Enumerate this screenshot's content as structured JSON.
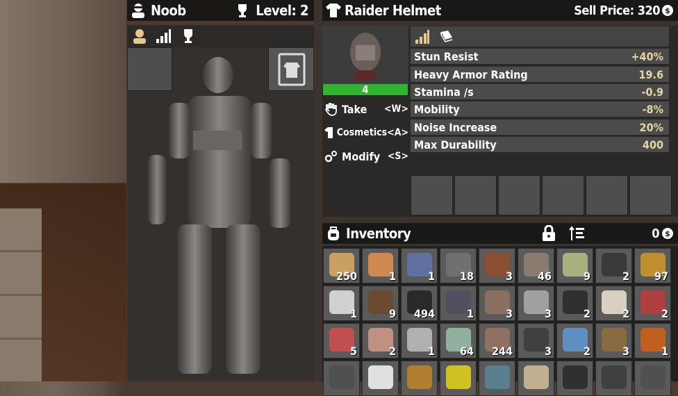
{
  "player": {
    "name": "Noob",
    "level_label": "Level: 2"
  },
  "item": {
    "title": "Raider Helmet",
    "sell_price_label": "Sell Price: 320",
    "quality": "4"
  },
  "actions": [
    {
      "label": "Take",
      "key": "<W>"
    },
    {
      "label": "Cosmetics",
      "key": "<A>"
    },
    {
      "label": "Modify",
      "key": "<S>"
    }
  ],
  "stats": [
    {
      "name": "Stun Resist",
      "value": "+40%"
    },
    {
      "name": "Heavy Armor Rating",
      "value": "19.6"
    },
    {
      "name": "Stamina /s",
      "value": "-0.9"
    },
    {
      "name": "Mobility",
      "value": "-8%"
    },
    {
      "name": "Noise Increase",
      "value": "20%"
    },
    {
      "name": "Max Durability",
      "value": "400"
    }
  ],
  "inventory": {
    "title": "Inventory",
    "money": "0",
    "slots": [
      {
        "count": "250",
        "color": "#c8a060"
      },
      {
        "count": "1",
        "color": "#d08a50"
      },
      {
        "count": "1",
        "color": "#6070a0"
      },
      {
        "count": "18",
        "color": "#707070"
      },
      {
        "count": "3",
        "color": "#8a5030"
      },
      {
        "count": "46",
        "color": "#8a7a70"
      },
      {
        "count": "9",
        "color": "#a8b080"
      },
      {
        "count": "2",
        "color": "#3a3a3a"
      },
      {
        "count": "97",
        "color": "#c09030"
      },
      {
        "count": "1",
        "color": "#d0d0d0"
      },
      {
        "count": "9",
        "color": "#6a4a30"
      },
      {
        "count": "494",
        "color": "#2a2a2a"
      },
      {
        "count": "1",
        "color": "#505060"
      },
      {
        "count": "3",
        "color": "#8a7060"
      },
      {
        "count": "3",
        "color": "#a0a0a0"
      },
      {
        "count": "2",
        "color": "#303030"
      },
      {
        "count": "2",
        "color": "#d8d0c0"
      },
      {
        "count": "2",
        "color": "#b04040"
      },
      {
        "count": "5",
        "color": "#c05050"
      },
      {
        "count": "2",
        "color": "#c09080"
      },
      {
        "count": "1",
        "color": "#b0b0b0"
      },
      {
        "count": "64",
        "color": "#90b0a0"
      },
      {
        "count": "244",
        "color": "#907060"
      },
      {
        "count": "3",
        "color": "#404040"
      },
      {
        "count": "2",
        "color": "#6090c0"
      },
      {
        "count": "3",
        "color": "#8a6a40"
      },
      {
        "count": "1",
        "color": "#c06020"
      },
      {
        "count": "",
        "color": "#505050"
      },
      {
        "count": "",
        "color": "#e0e0e0"
      },
      {
        "count": "",
        "color": "#b08030"
      },
      {
        "count": "",
        "color": "#d0c020"
      },
      {
        "count": "",
        "color": "#5a8090"
      },
      {
        "count": "",
        "color": "#c0b090"
      },
      {
        "count": "",
        "color": "#303030"
      },
      {
        "count": "",
        "color": "#404040"
      },
      {
        "count": "",
        "color": "#505050"
      }
    ]
  },
  "colors": {
    "quality_bar": "#2fb52f",
    "stat_value": "#e6d5a0"
  }
}
